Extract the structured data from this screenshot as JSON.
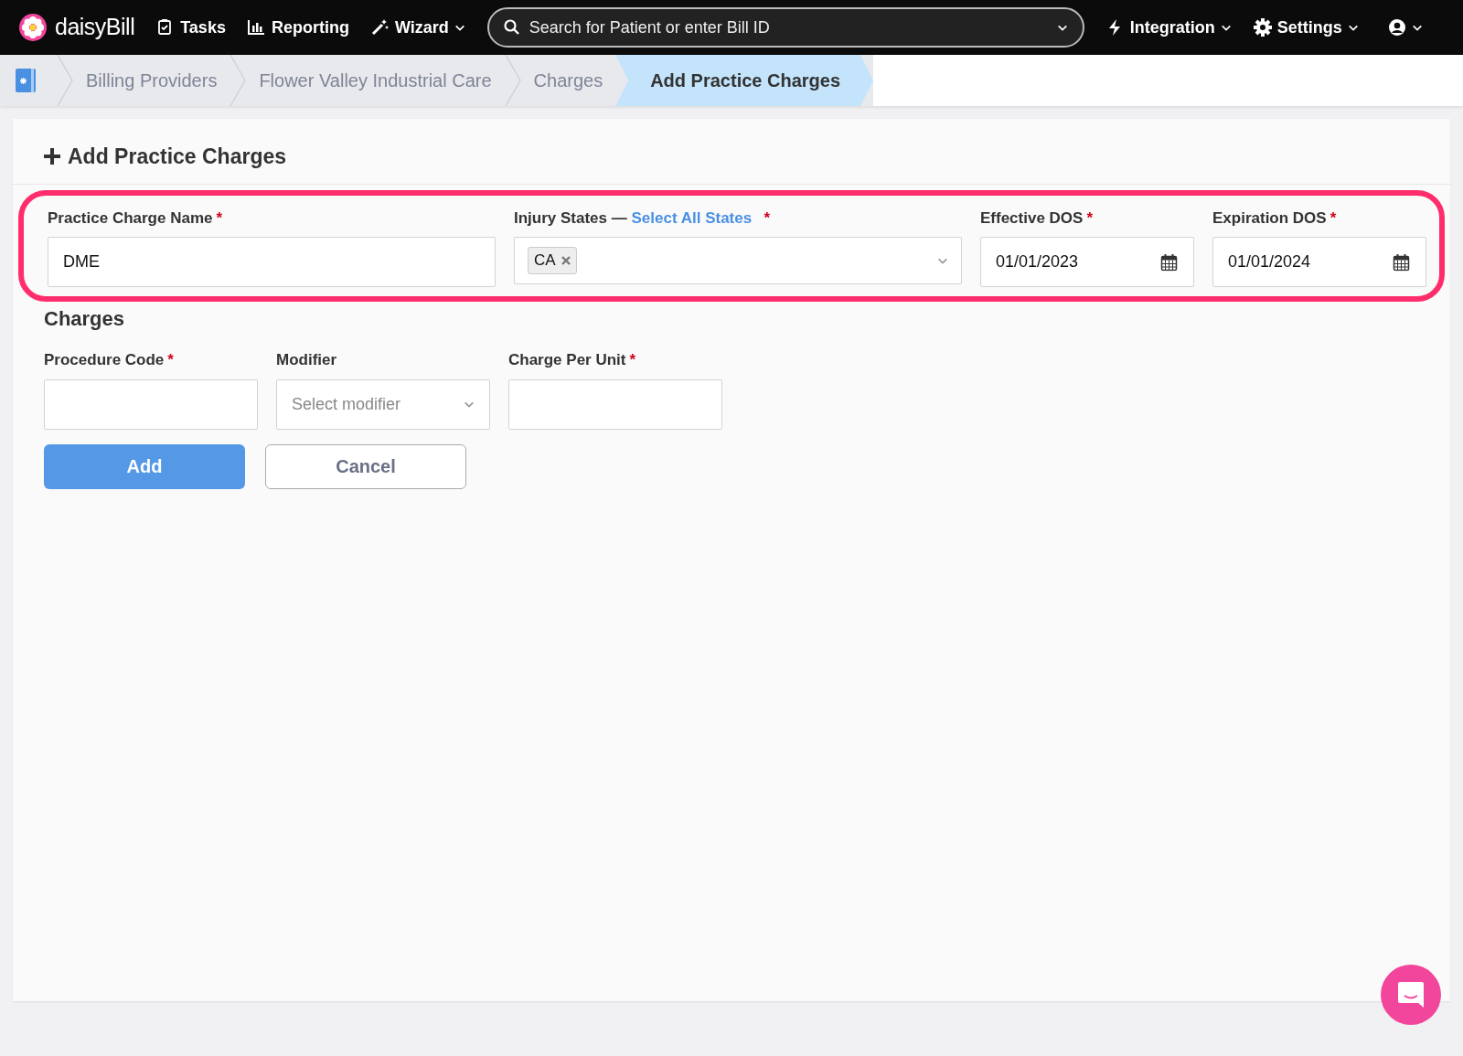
{
  "navbar": {
    "brand": "daisyBill",
    "items": [
      {
        "label": "Tasks",
        "dropdown": false
      },
      {
        "label": "Reporting",
        "dropdown": false
      },
      {
        "label": "Wizard",
        "dropdown": true
      }
    ],
    "search": {
      "placeholder": "Search for Patient or enter Bill ID"
    },
    "right_items": [
      {
        "label": "Integration",
        "dropdown": true
      },
      {
        "label": "Settings",
        "dropdown": true
      }
    ]
  },
  "breadcrumb": [
    {
      "label": "Billing Providers",
      "selected": false
    },
    {
      "label": "Flower Valley Industrial Care",
      "selected": false
    },
    {
      "label": "Charges",
      "selected": false
    },
    {
      "label": "Add Practice Charges",
      "selected": true
    }
  ],
  "card": {
    "title": "Add Practice Charges",
    "highlighted_row": {
      "highlighted": true,
      "fields": [
        {
          "kind": "text",
          "label": "Practice Charge Name",
          "required_mark": "*",
          "value": "DME"
        },
        {
          "kind": "multiselect",
          "label": "Injury States —",
          "link": "Select All States",
          "required_mark": "*",
          "tags": [
            "CA"
          ]
        },
        {
          "kind": "date",
          "label": "Effective DOS",
          "required_mark": "*",
          "value": "01/01/2023"
        },
        {
          "kind": "date",
          "label": "Expiration DOS",
          "required_mark": "*",
          "value": "01/01/2024"
        }
      ]
    },
    "section_title": "Charges",
    "fields": [
      {
        "kind": "text",
        "label": "Procedure Code",
        "required_mark": "*"
      },
      {
        "kind": "select",
        "label": "Modifier",
        "placeholder": "Select modifier"
      },
      {
        "kind": "text",
        "label": "Charge Per Unit",
        "required_mark": "*"
      }
    ],
    "buttons": [
      {
        "label": "Add",
        "kind": "primary"
      },
      {
        "label": "Cancel",
        "kind": "secondary"
      }
    ]
  }
}
